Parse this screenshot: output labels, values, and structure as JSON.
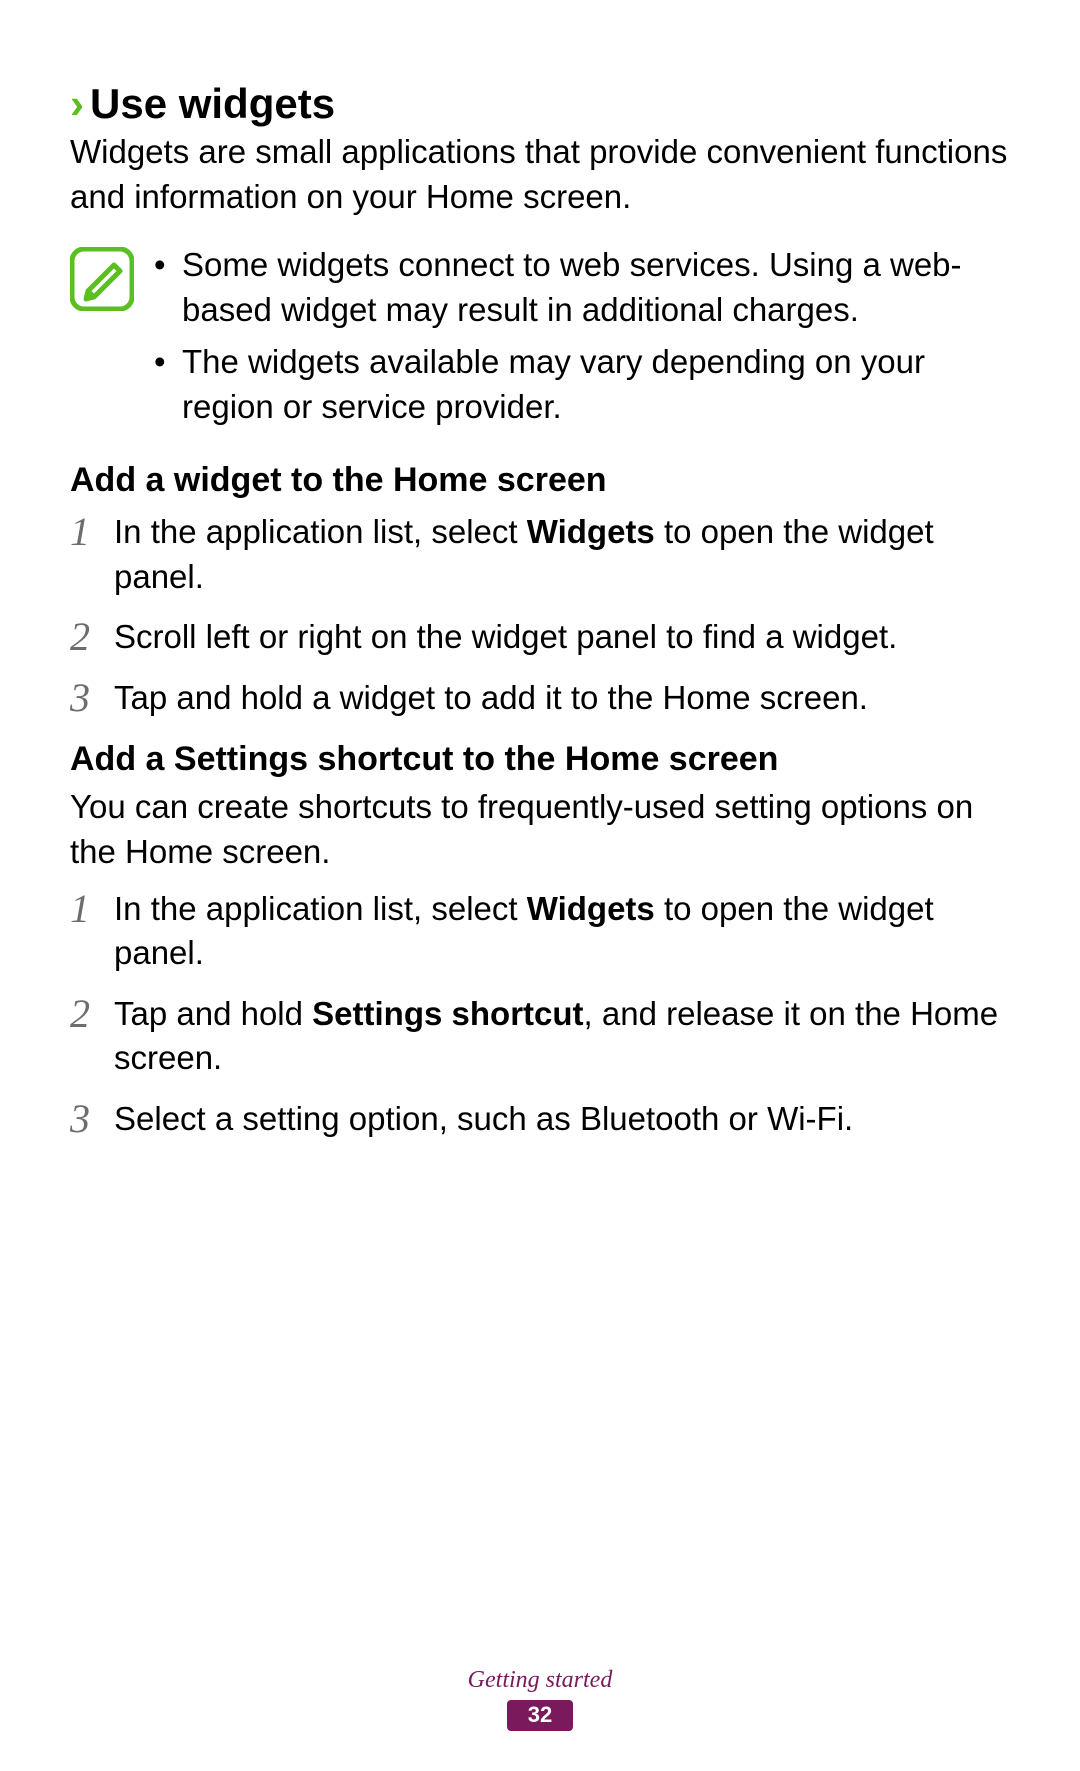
{
  "heading": {
    "chevron": "›",
    "title": "Use widgets"
  },
  "intro": "Widgets are small applications that provide convenient functions and information on your Home screen.",
  "notes": {
    "items": [
      "Some widgets connect to web services. Using a web-based widget may result in additional charges.",
      "The widgets available may vary depending on your region or service provider."
    ]
  },
  "sectionA": {
    "title": "Add a widget to the Home screen",
    "steps": [
      {
        "n": "1",
        "pre": "In the application list, select ",
        "bold": "Widgets",
        "post": " to open the widget panel."
      },
      {
        "n": "2",
        "pre": "Scroll left or right on the widget panel to find a widget.",
        "bold": "",
        "post": ""
      },
      {
        "n": "3",
        "pre": "Tap and hold a widget to add it to the Home screen.",
        "bold": "",
        "post": ""
      }
    ]
  },
  "sectionB": {
    "title": "Add a Settings shortcut to the Home screen",
    "intro": "You can create shortcuts to frequently-used setting options on the Home screen.",
    "steps": [
      {
        "n": "1",
        "pre": "In the application list, select ",
        "bold": "Widgets",
        "post": " to open the widget panel."
      },
      {
        "n": "2",
        "pre": "Tap and hold ",
        "bold": "Settings shortcut",
        "post": ", and release it on the Home screen."
      },
      {
        "n": "3",
        "pre": "Select a setting option, such as Bluetooth or Wi-Fi.",
        "bold": "",
        "post": ""
      }
    ]
  },
  "footer": {
    "section": "Getting started",
    "page": "32"
  }
}
